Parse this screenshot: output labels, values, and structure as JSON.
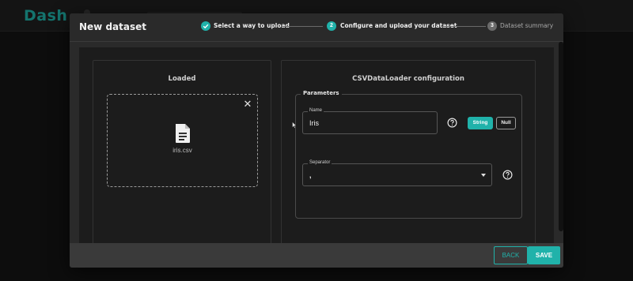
{
  "app": {
    "logo_text": "Dash"
  },
  "modal": {
    "title": "New dataset",
    "steps": [
      {
        "number": "1",
        "label": "Select a way to upload",
        "state": "completed"
      },
      {
        "number": "2",
        "label": "Configure and upload your dataset",
        "state": "active"
      },
      {
        "number": "3",
        "label": "Dataset summary",
        "state": "pending"
      }
    ]
  },
  "loaded_panel": {
    "title": "Loaded",
    "file_name": "iris.csv",
    "file_icon": "document-icon",
    "close_icon": "close-icon"
  },
  "config_panel": {
    "title": "CSVDataLoader configuration",
    "parameters_legend": "Parameters",
    "name_field": {
      "label": "Name",
      "value": "Iris"
    },
    "type_chips": {
      "string": "String",
      "null": "Null",
      "selected": "String"
    },
    "separator_field": {
      "label": "Separator",
      "value": ","
    }
  },
  "footer": {
    "back_label": "BACK",
    "save_label": "SAVE"
  },
  "colors": {
    "accent": "#20b2aa",
    "modal_bg": "#2a2a2a",
    "body_bg": "#1c1c1c",
    "footer_bg": "#3a3a3a",
    "page_bg": "#141414"
  }
}
